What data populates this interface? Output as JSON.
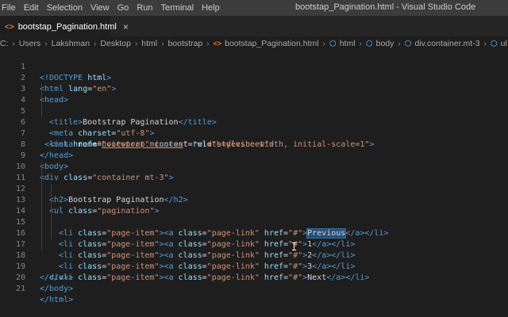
{
  "menu": [
    "File",
    "Edit",
    "Selection",
    "View",
    "Go",
    "Run",
    "Terminal",
    "Help"
  ],
  "window_title": "bootstap_Pagination.html - Visual Studio Code",
  "tab": {
    "icon": "html-file-icon",
    "label": "bootstap_Pagination.html",
    "close": "×"
  },
  "breadcrumb": [
    "C:",
    "Users",
    "Lakshman",
    "Desktop",
    "html",
    "bootstrap",
    "bootstap_Pagination.html",
    "html",
    "body",
    "div.container.mt-3",
    "ul.paginat"
  ],
  "line_numbers": [
    "1",
    "2",
    "3",
    "4",
    "5",
    "6",
    "7",
    "8",
    "9",
    "10",
    "11",
    "12",
    "13",
    "14",
    "15",
    "16",
    "17",
    "18",
    "19",
    "20",
    "21"
  ],
  "code": {
    "l1": [
      "<!DOCTYPE",
      " html",
      ">"
    ],
    "l2": [
      "<html",
      " lang",
      "=",
      "\"en\"",
      ">"
    ],
    "l3": [
      "<head>"
    ],
    "l4": [
      "<title>",
      "Bootstrap Pagination",
      "</title>"
    ],
    "l5": [
      "<meta",
      " charset",
      "=",
      "\"utf-8\"",
      ">"
    ],
    "l6": [
      "<meta",
      " name",
      "=",
      "\"viewport\"",
      " content",
      "=",
      "\"width=device-width, initial-scale=1\"",
      ">"
    ],
    "l7": [
      "<link",
      " href",
      "=",
      "\"",
      "bootstrap.min.css",
      "\"",
      " rel",
      "=",
      "\"stylesheet\"",
      ">"
    ],
    "l8": [
      "</head>"
    ],
    "l9": [
      "<body>"
    ],
    "l10": [
      "<div",
      " class",
      "=",
      "\"container mt-3\"",
      ">"
    ],
    "l11": [
      "<h2>",
      "Bootstrap Pagination",
      "</h2>"
    ],
    "l12": [
      "<ul",
      " class",
      "=",
      "\"pagination\"",
      ">"
    ],
    "li_parts": [
      "<li",
      " class",
      "=",
      "\"page-item\"",
      "><a",
      " class",
      "=",
      "\"page-link\"",
      " href",
      "=",
      "\"#\"",
      ">"
    ],
    "items": [
      "Previous",
      "1",
      "2",
      "3",
      "Next"
    ],
    "li_close": [
      "</a></li>"
    ],
    "l18": [
      "</ul>"
    ],
    "l19": [
      "</div>"
    ],
    "l20": [
      "</body>"
    ],
    "l21": [
      "</html>"
    ]
  }
}
